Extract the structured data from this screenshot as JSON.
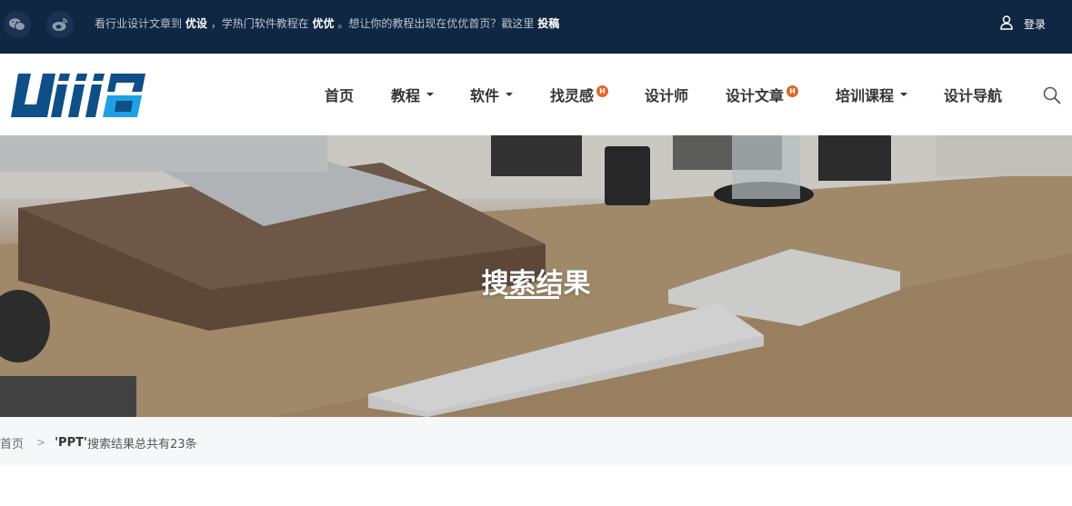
{
  "topbar": {
    "notice_prefix": "看行业设计文章到",
    "notice_brand1": "优设",
    "notice_mid1": "，学热门软件教程在",
    "notice_brand2": "优优",
    "notice_mid2": "。想让你的教程出现在优优首页？戳这里",
    "notice_link": "投稿",
    "login_label": "登录",
    "icons": [
      "wechat-icon",
      "weibo-icon",
      "user-icon"
    ]
  },
  "nav": {
    "items": [
      {
        "label": "首页",
        "dropdown": false,
        "hot": false
      },
      {
        "label": "教程",
        "dropdown": true,
        "hot": false
      },
      {
        "label": "软件",
        "dropdown": true,
        "hot": false
      },
      {
        "label": "找灵感",
        "dropdown": false,
        "hot": true
      },
      {
        "label": "设计师",
        "dropdown": false,
        "hot": false
      },
      {
        "label": "设计文章",
        "dropdown": false,
        "hot": true
      },
      {
        "label": "培训课程",
        "dropdown": true,
        "hot": false
      },
      {
        "label": "设计导航",
        "dropdown": false,
        "hot": false
      }
    ],
    "hot_badge": "H"
  },
  "hero": {
    "title": "搜索结果"
  },
  "breadcrumb": {
    "home": "首页",
    "separator": ">",
    "keyword": "'PPT'",
    "result_text": "搜索结果总共有23条"
  },
  "colors": {
    "topbar_bg": "#0f2743",
    "logo_dark": "#0d4f86",
    "logo_light": "#1da1e6",
    "hot_badge": "#e0662c"
  }
}
